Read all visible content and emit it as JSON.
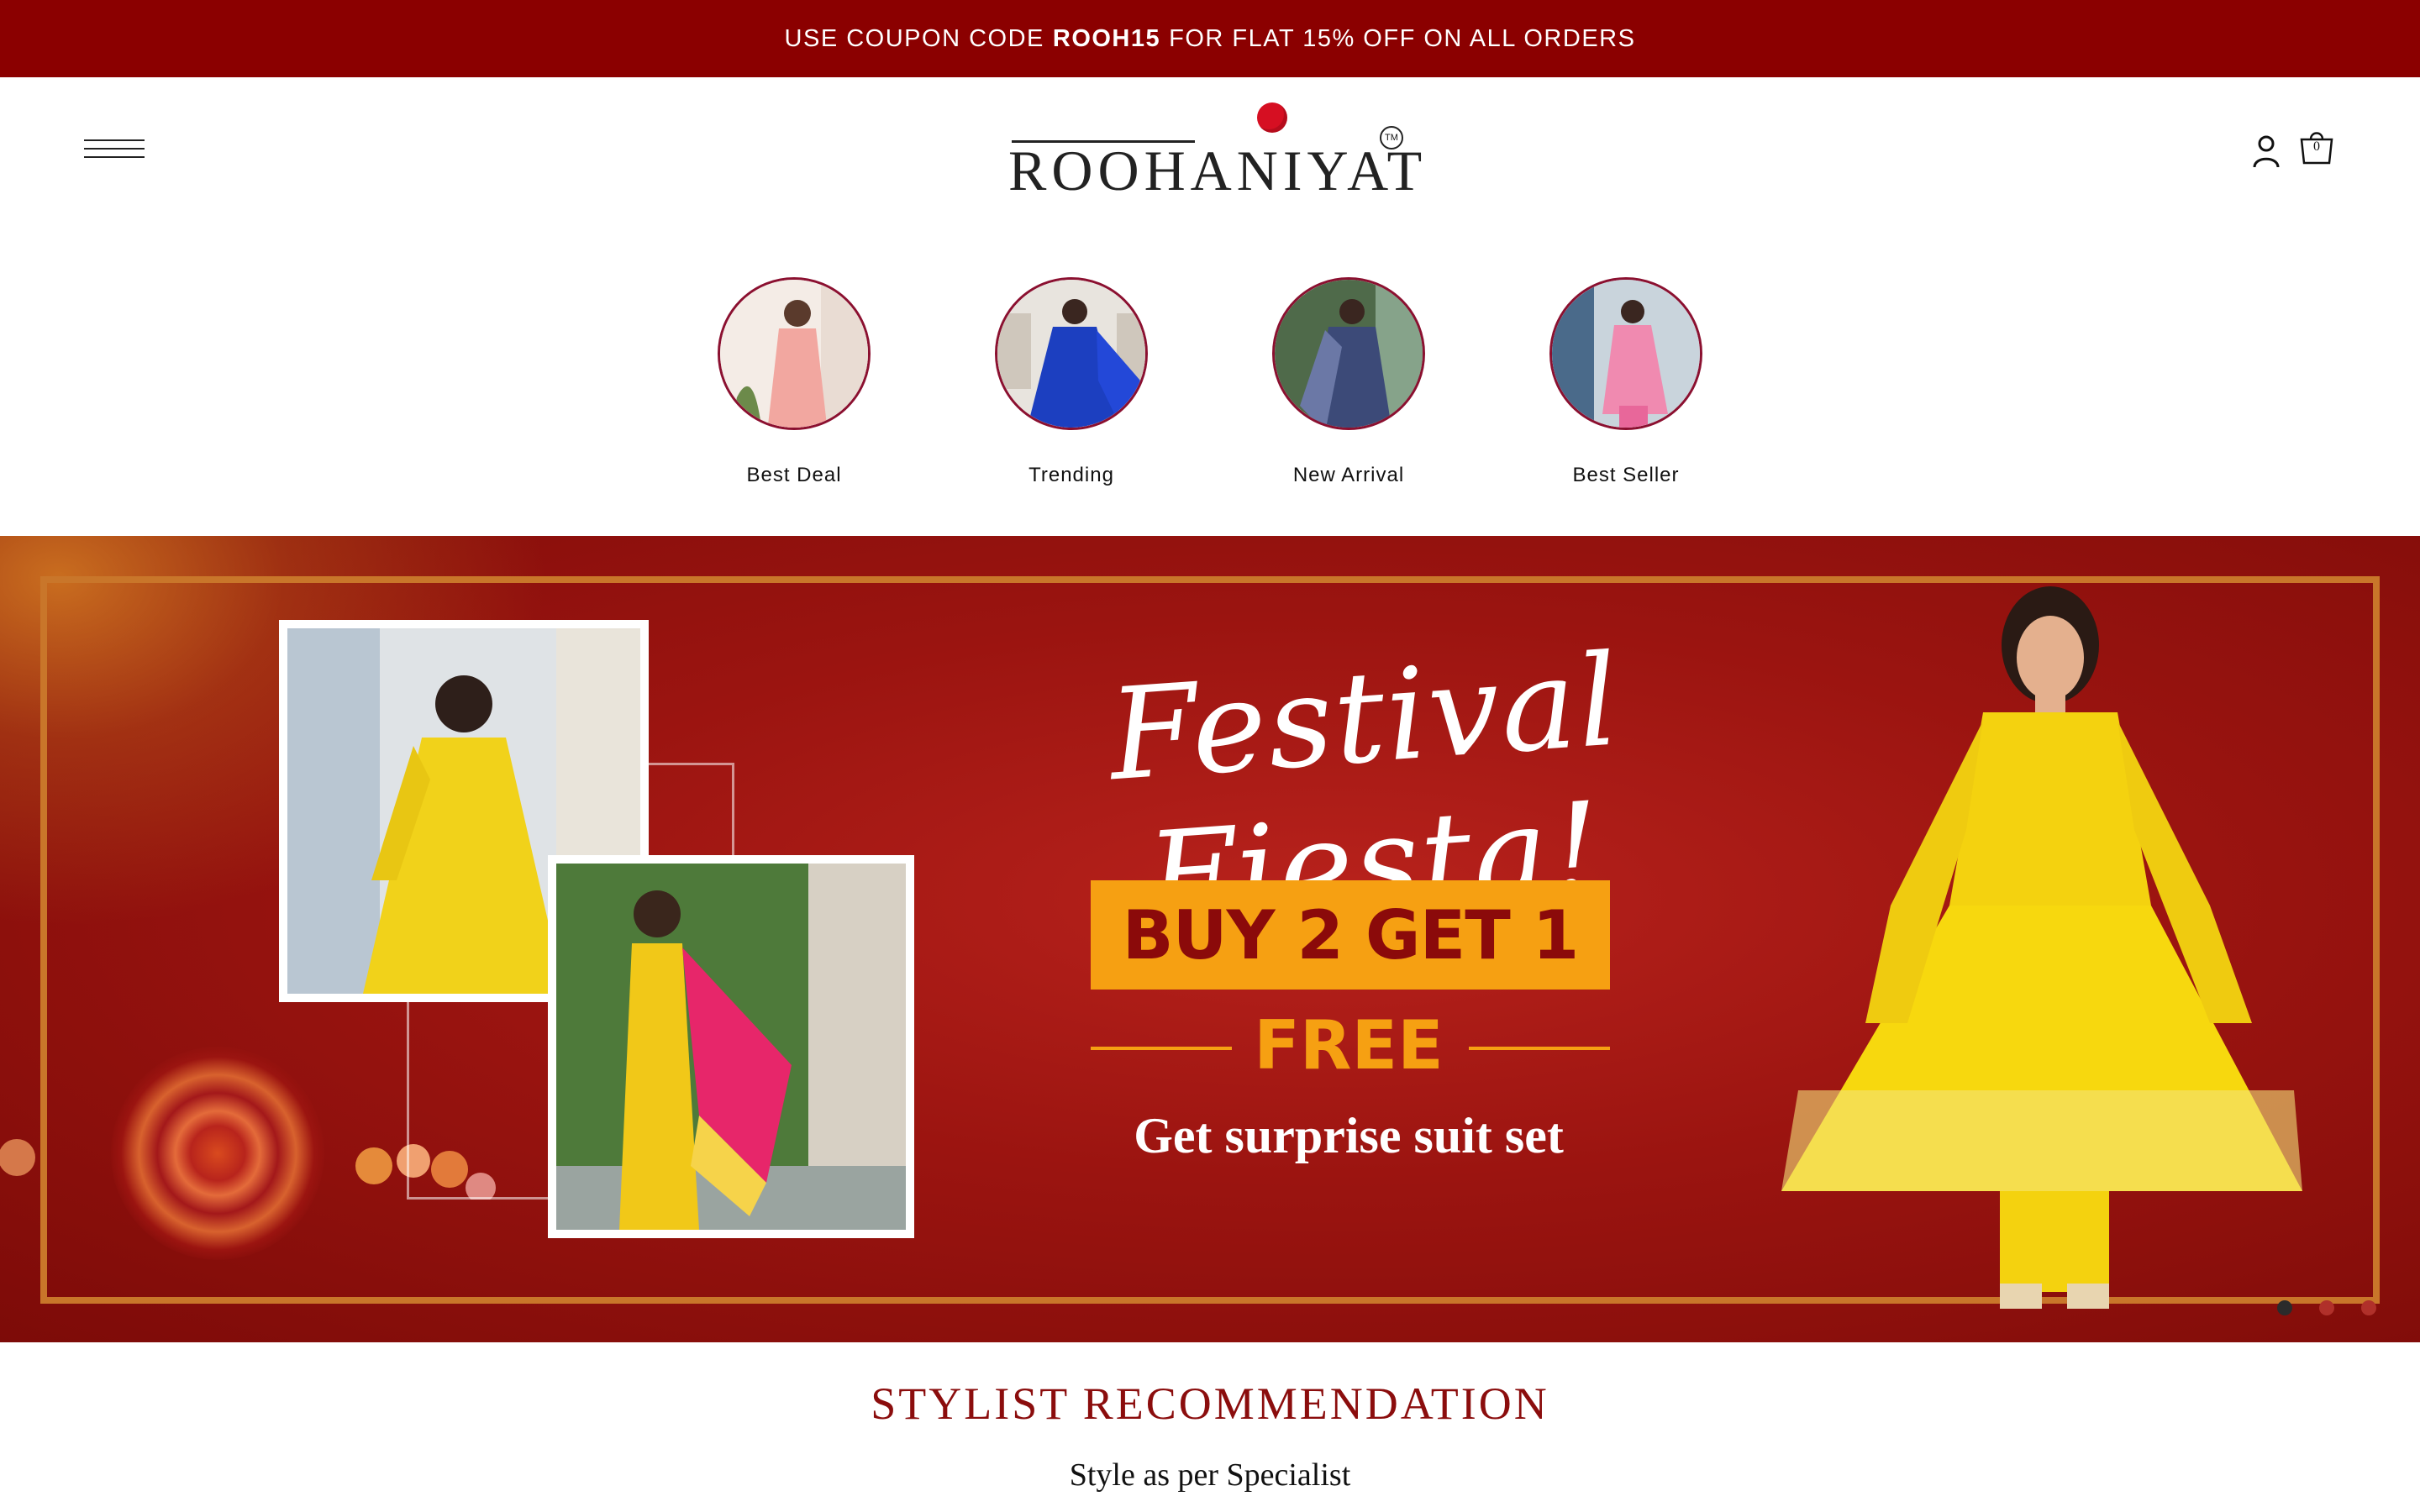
{
  "announcement": {
    "prefix": "USE COUPON CODE",
    "code": "ROOH15",
    "suffix": "FOR FLAT 15% OFF ON ALL ORDERS"
  },
  "header": {
    "logo_text": "ROOHANIYAT",
    "logo_tm": "TM",
    "cart_count": "0",
    "icons": [
      "hamburger-menu-icon",
      "user-icon",
      "shopping-bag-icon"
    ]
  },
  "categories": [
    {
      "label": "Best Deal",
      "color": "#f2a7a0"
    },
    {
      "label": "Trending",
      "color": "#1c3fc0"
    },
    {
      "label": "New Arrival",
      "color": "#3c4a78"
    },
    {
      "label": "Best Seller",
      "color": "#f08ab0"
    }
  ],
  "banner": {
    "title": "Festival Fiesta!",
    "offer": "BUY 2 GET 1",
    "free": "FREE",
    "tagline": "Get surprise suit set",
    "slides": 3,
    "active_slide": 1
  },
  "section": {
    "title": "STYLIST RECOMMENDATION",
    "subtitle": "Style as per Specialist"
  },
  "colors": {
    "brand_maroon": "#8b0000",
    "offer_orange": "#f6a012",
    "logo_red": "#d60f22"
  }
}
